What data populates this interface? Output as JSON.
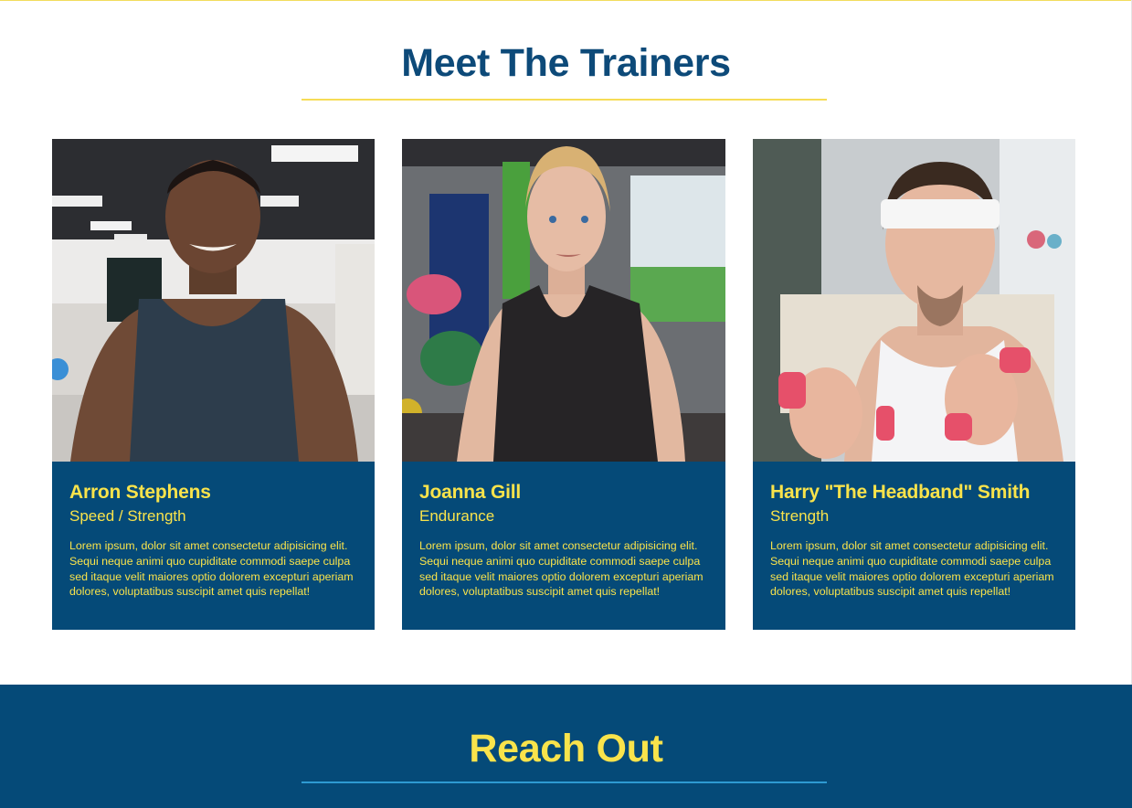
{
  "trainers": {
    "title": "Meet The Trainers",
    "cards": [
      {
        "name": "Arron Stephens",
        "specialty": "Speed / Strength",
        "bio": "Lorem ipsum, dolor sit amet consectetur adipisicing elit. Sequi neque animi quo cupiditate commodi saepe culpa sed itaque velit maiores optio dolorem excepturi aperiam dolores, voluptatibus suscipit amet quis repellat!"
      },
      {
        "name": "Joanna Gill",
        "specialty": "Endurance",
        "bio": "Lorem ipsum, dolor sit amet consectetur adipisicing elit. Sequi neque animi quo cupiditate commodi saepe culpa sed itaque velit maiores optio dolorem excepturi aperiam dolores, voluptatibus suscipit amet quis repellat!"
      },
      {
        "name": "Harry \"The Headband\" Smith",
        "specialty": "Strength",
        "bio": "Lorem ipsum, dolor sit amet consectetur adipisicing elit. Sequi neque animi quo cupiditate commodi saepe culpa sed itaque velit maiores optio dolorem excepturi aperiam dolores, voluptatibus suscipit amet quis repellat!"
      }
    ]
  },
  "reach_out": {
    "title": "Reach Out"
  },
  "colors": {
    "brand_blue": "#054a78",
    "title_blue": "#0d4a79",
    "accent_yellow": "#f9e34b",
    "underline_yellow": "#f6dc56",
    "underline_cyan": "#2e9ad2"
  }
}
